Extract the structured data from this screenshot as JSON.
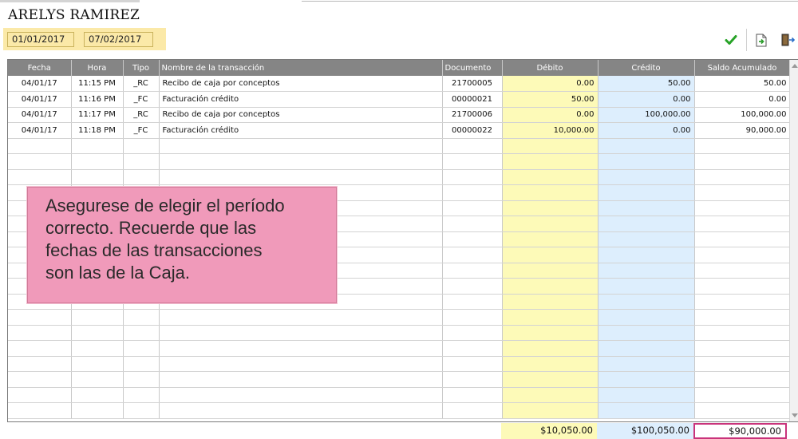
{
  "customer_name": "ARELYS RAMIREZ",
  "date_range": {
    "from": "01/01/2017",
    "to": "07/02/2017"
  },
  "toolbar": {
    "accept_icon": "checkmark-icon",
    "export_icon": "export-document-icon",
    "exit_icon": "exit-door-icon"
  },
  "grid": {
    "columns": [
      "Fecha",
      "Hora",
      "Tipo",
      "Nombre de la transacción",
      "Documento",
      "Débito",
      "Crédito",
      "Saldo Acumulado"
    ],
    "rows": [
      [
        "04/01/17",
        "11:15 PM",
        "_RC",
        "Recibo de caja por conceptos",
        "21700005",
        "0.00",
        "50.00",
        "50.00"
      ],
      [
        "04/01/17",
        "11:16 PM",
        "_FC",
        "Facturación crédito",
        "00000021",
        "50.00",
        "0.00",
        "0.00"
      ],
      [
        "04/01/17",
        "11:17 PM",
        "_RC",
        "Recibo de caja por conceptos",
        "21700006",
        "0.00",
        "100,000.00",
        "100,000.00"
      ],
      [
        "04/01/17",
        "11:18 PM",
        "_FC",
        "Facturación crédito",
        "00000022",
        "10,000.00",
        "0.00",
        "90,000.00"
      ]
    ],
    "empty_rows": 18
  },
  "totals": {
    "debit": "$10,050.00",
    "credit": "$100,050.00",
    "balance": "$90,000.00"
  },
  "note": "Asegurese de elegir el período\ncorrecto. Recuerde que las\nfechas de las transacciones\nson las de la Caja.",
  "colors": {
    "debit_column": "#fdfab8",
    "credit_column": "#ddeefd",
    "header": "#858585",
    "date_panel": "#fbe9a8",
    "note_background": "#f09aba",
    "balance_highlight": "#c9337b"
  }
}
